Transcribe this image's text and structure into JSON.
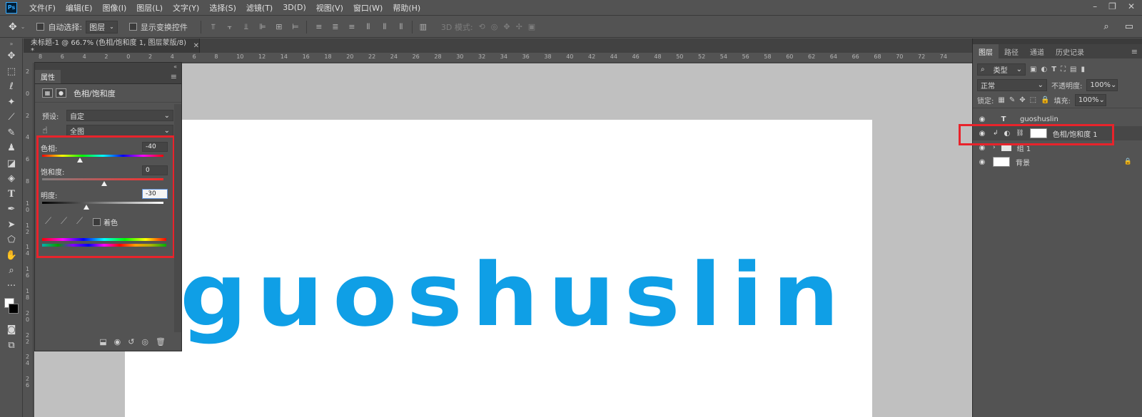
{
  "menu": {
    "logo": "Ps",
    "items": [
      "文件(F)",
      "编辑(E)",
      "图像(I)",
      "图层(L)",
      "文字(Y)",
      "选择(S)",
      "滤镜(T)",
      "3D(D)",
      "视图(V)",
      "窗口(W)",
      "帮助(H)"
    ]
  },
  "options": {
    "auto_select_label": "自动选择:",
    "auto_select_value": "图层",
    "show_transform_label": "显示变换控件",
    "mode_3d_label": "3D 模式:"
  },
  "document": {
    "tab_title": "未标题-1 @ 66.7% (色相/饱和度 1, 图层蒙版/8) *",
    "canvas_text": "guoshuslin",
    "ruler_h": [
      "8",
      "6",
      "4",
      "2",
      "0",
      "2",
      "4",
      "6",
      "8",
      "10",
      "12",
      "14",
      "16",
      "18",
      "20",
      "22",
      "24",
      "26",
      "28",
      "30",
      "32",
      "34",
      "36",
      "38",
      "40",
      "42",
      "44",
      "46",
      "48",
      "50",
      "52",
      "54",
      "56",
      "58",
      "60",
      "62",
      "64",
      "66",
      "68",
      "70",
      "72",
      "74"
    ],
    "ruler_v": [
      "2",
      "0",
      "2",
      "4",
      "6",
      "8",
      "1 0",
      "1 2",
      "1 4",
      "1 6",
      "1 8",
      "2 0",
      "2 2",
      "2 4",
      "2 6"
    ]
  },
  "properties": {
    "tab_label": "属性",
    "title": "色相/饱和度",
    "preset_label": "预设:",
    "preset_value": "自定",
    "range_value": "全图",
    "hue_label": "色相:",
    "hue_value": "-40",
    "saturation_label": "饱和度:",
    "saturation_value": "0",
    "lightness_label": "明度:",
    "lightness_value": "-30",
    "colorize_label": "着色"
  },
  "layers_panel": {
    "tabs": [
      "图层",
      "路径",
      "通道",
      "历史记录"
    ],
    "filter_kind": "类型",
    "blend_mode": "正常",
    "opacity_label": "不透明度:",
    "opacity_value": "100%",
    "lock_label": "锁定:",
    "fill_label": "填充:",
    "fill_value": "100%",
    "layers": [
      {
        "name": "guoshuslin",
        "type": "text"
      },
      {
        "name": "色相/饱和度 1",
        "type": "adjustment"
      },
      {
        "name": "组 1",
        "type": "group"
      },
      {
        "name": "背景",
        "type": "background"
      }
    ]
  },
  "colors": {
    "text_blue": "#0f9fe6",
    "highlight_red": "#e8232b",
    "panel_bg": "#535353"
  }
}
